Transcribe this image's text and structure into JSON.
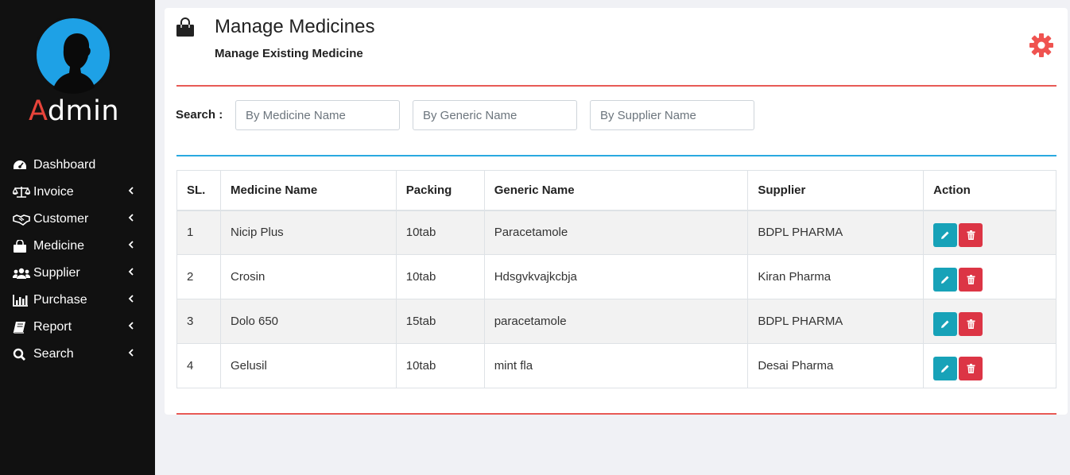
{
  "sidebar": {
    "brand_first": "A",
    "brand_rest": "dmin",
    "items": [
      {
        "label": "Dashboard",
        "icon": "tachometer-icon",
        "has_submenu": false
      },
      {
        "label": "Invoice",
        "icon": "balance-scale-icon",
        "has_submenu": true
      },
      {
        "label": "Customer",
        "icon": "handshake-icon",
        "has_submenu": true
      },
      {
        "label": "Medicine",
        "icon": "shopping-bag-icon",
        "has_submenu": true
      },
      {
        "label": "Supplier",
        "icon": "users-icon",
        "has_submenu": true
      },
      {
        "label": "Purchase",
        "icon": "bar-chart-icon",
        "has_submenu": true
      },
      {
        "label": "Report",
        "icon": "book-icon",
        "has_submenu": true
      },
      {
        "label": "Search",
        "icon": "search-icon",
        "has_submenu": true
      }
    ]
  },
  "header": {
    "title": "Manage Medicines",
    "subtitle": "Manage Existing Medicine"
  },
  "search": {
    "label": "Search :",
    "medicine_placeholder": "By Medicine Name",
    "generic_placeholder": "By Generic Name",
    "supplier_placeholder": "By Supplier Name"
  },
  "table": {
    "columns": [
      "SL.",
      "Medicine Name",
      "Packing",
      "Generic Name",
      "Supplier",
      "Action"
    ],
    "rows": [
      {
        "sl": "1",
        "name": "Nicip Plus",
        "packing": "10tab",
        "generic": "Paracetamole",
        "supplier": "BDPL PHARMA"
      },
      {
        "sl": "2",
        "name": "Crosin",
        "packing": "10tab",
        "generic": "Hdsgvkvajkcbja",
        "supplier": "Kiran Pharma"
      },
      {
        "sl": "3",
        "name": "Dolo 650",
        "packing": "15tab",
        "generic": "paracetamole",
        "supplier": "BDPL PHARMA"
      },
      {
        "sl": "4",
        "name": "Gelusil",
        "packing": "10tab",
        "generic": "mint fla",
        "supplier": "Desai Pharma"
      }
    ]
  },
  "colors": {
    "accent_red": "#e85a55",
    "accent_blue": "#2aa9e0",
    "edit_button": "#17a2b8",
    "delete_button": "#dc3545",
    "sidebar_bg": "#111111"
  }
}
